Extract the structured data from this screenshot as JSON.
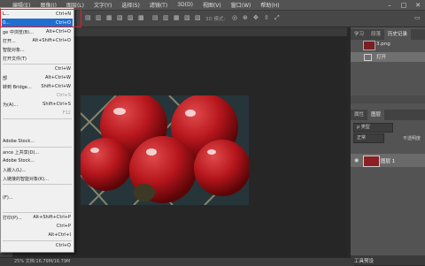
{
  "menubar": {
    "items": [
      "编辑(E)",
      "图像(I)",
      "图层(L)",
      "文字(Y)",
      "选择(S)",
      "滤镜(T)",
      "3D(D)",
      "视图(V)",
      "窗口(W)",
      "帮助(H)"
    ]
  },
  "window_controls": [
    "–",
    "□",
    "✕"
  ],
  "options_bar": {
    "mode_label": "3D 模式:"
  },
  "status_bar": {
    "zoom": "25%  文档:16.79M/16.79M"
  },
  "history_panel": {
    "tabs": [
      "学习",
      "段落",
      "历史记录"
    ],
    "snapshot_name": "3.png",
    "step": "打开"
  },
  "layers_panel": {
    "tabs": [
      "属性",
      "图层"
    ],
    "filter": "ρ 类型",
    "blend_mode": "正常",
    "opacity_label": "不透明度",
    "layer_name": "图层 1"
  },
  "workspace_label": "工具预设",
  "file_menu": {
    "items": [
      {
        "label": "L...",
        "shortcut": "Ctrl+N"
      },
      {
        "label": "0...",
        "shortcut": "Ctrl+O",
        "highlight": true
      },
      {
        "label": "ge 中浏览(B)...",
        "shortcut": "Alt+Ctrl+O"
      },
      {
        "label": "打开...",
        "shortcut": "Alt+Shift+Ctrl+O"
      },
      {
        "label": "智能对象..."
      },
      {
        "label": "打开文件(T)"
      },
      {
        "label": "",
        "shortcut": "Ctrl+W"
      },
      {
        "label": "部",
        "shortcut": "Alt+Ctrl+W"
      },
      {
        "label": "转到 Bridge...",
        "shortcut": "Shift+Ctrl+W"
      },
      {
        "label": "",
        "shortcut": "Ctrl+S",
        "dim": true
      },
      {
        "label": "为(A)...",
        "shortcut": "Shift+Ctrl+S"
      },
      {
        "label": "",
        "shortcut": "F12",
        "dim": true
      },
      {
        "label": ""
      },
      {
        "label": ""
      },
      {
        "label": "Adobe Stock..."
      },
      {
        "label": "ance 上共享(D)..."
      },
      {
        "label": "Adobe Stock..."
      },
      {
        "label": "入嵌入(L)..."
      },
      {
        "label": "入链接的智能对象(K)..."
      },
      {
        "label": ""
      },
      {
        "label": "(F)..."
      },
      {
        "label": ""
      },
      {
        "label": "打印(P)...",
        "shortcut": "Alt+Shift+Ctrl+P"
      },
      {
        "label": "",
        "shortcut": "Ctrl+P"
      },
      {
        "label": "",
        "shortcut": "Alt+Ctrl+I"
      },
      {
        "label": "",
        "shortcut": "Ctrl+Q"
      }
    ]
  }
}
